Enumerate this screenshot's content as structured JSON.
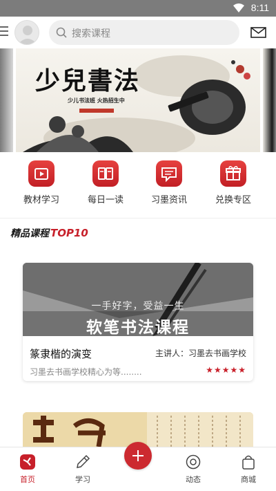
{
  "status_bar": {
    "time": "8:11"
  },
  "search": {
    "placeholder": "搜索课程"
  },
  "banner": {
    "title": "少兒書法",
    "subtitle": "少儿书法班 火热招生中"
  },
  "quick_actions": [
    {
      "label": "教材学习",
      "icon": "video-icon"
    },
    {
      "label": "每日一读",
      "icon": "book-icon"
    },
    {
      "label": "习墨资讯",
      "icon": "message-icon"
    },
    {
      "label": "兑换专区",
      "icon": "gift-icon"
    }
  ],
  "section": {
    "title_cn": "精品课程",
    "title_en": "TOP10"
  },
  "course_card": {
    "image_line1": "一手好字，受益一生",
    "image_line2": "软笔书法课程",
    "title": "篆隶楷的演变",
    "teacher": "主讲人：习墨去书画学校",
    "description": "习墨去书画学校精心为等........",
    "rating": 5,
    "stars": "★★★★★"
  },
  "tabbar": [
    {
      "label": "首页",
      "icon": "home-icon",
      "active": true
    },
    {
      "label": "学习",
      "icon": "pen-icon",
      "active": false
    },
    {
      "label": "动态",
      "icon": "chat-icon",
      "active": false
    },
    {
      "label": "商城",
      "icon": "bag-icon",
      "active": false
    }
  ],
  "colors": {
    "accent": "#c7202a",
    "status_bar": "#7c7c7c"
  }
}
